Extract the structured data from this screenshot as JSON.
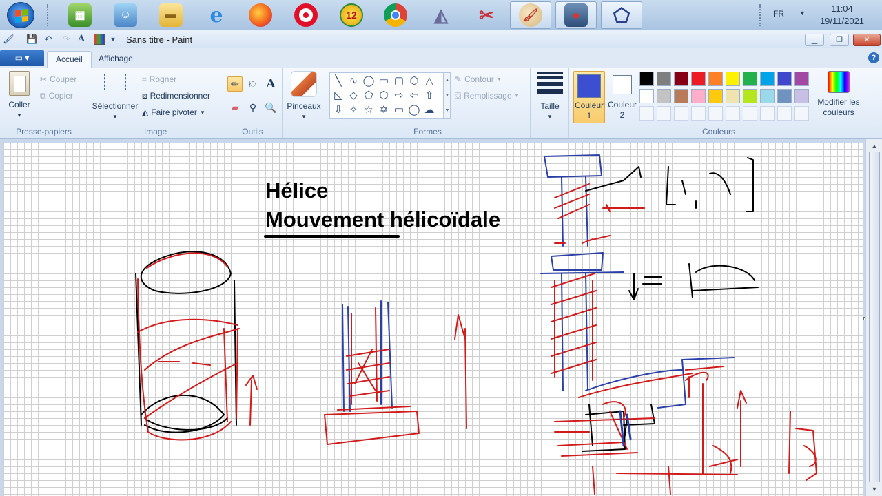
{
  "taskbar": {
    "apps": [
      {
        "name": "fichiers-icon"
      },
      {
        "name": "user-photo-icon"
      },
      {
        "name": "folder-icon"
      },
      {
        "name": "internet-explorer-icon"
      },
      {
        "name": "firefox-icon"
      },
      {
        "name": "opera-icon"
      },
      {
        "name": "app-12-icon",
        "label": "12"
      },
      {
        "name": "chrome-icon"
      },
      {
        "name": "geogebra-icon"
      },
      {
        "name": "snipping-tool-icon"
      },
      {
        "name": "paint-icon"
      },
      {
        "name": "media-icon"
      },
      {
        "name": "polygon-app-icon"
      }
    ],
    "language": "FR",
    "time": "11:04",
    "date": "19/11/2021"
  },
  "titlebar": {
    "title": "Sans titre - Paint"
  },
  "tabs": {
    "home": "Accueil",
    "view": "Affichage"
  },
  "ribbon": {
    "clipboard": {
      "paste": "Coller",
      "cut": "Couper",
      "copy": "Copier",
      "label": "Presse-papiers"
    },
    "image": {
      "select": "Sélectionner",
      "crop": "Rogner",
      "resize": "Redimensionner",
      "rotate": "Faire pivoter",
      "label": "Image"
    },
    "tools": {
      "label": "Outils"
    },
    "brushes": {
      "label": "Pinceaux"
    },
    "shapes": {
      "outline": "Contour",
      "fill": "Remplissage",
      "label": "Formes"
    },
    "size": {
      "label": "Taille"
    },
    "colors": {
      "color1_line1": "Couleur",
      "color1_line2": "1",
      "color2_line1": "Couleur",
      "color2_line2": "2",
      "edit_line1": "Modifier les",
      "edit_line2": "couleurs",
      "label": "Couleurs",
      "color1": "#3c4fd0",
      "color2": "#ffffff",
      "palette_row1": [
        "#000000",
        "#7f7f7f",
        "#880015",
        "#ed1c24",
        "#ff7f27",
        "#fff200",
        "#22b14c",
        "#00a2e8",
        "#3f48cc",
        "#a349a4"
      ],
      "palette_row2": [
        "#ffffff",
        "#c3c3c3",
        "#b97a57",
        "#ffaec9",
        "#ffc90e",
        "#efe4b0",
        "#b5e61d",
        "#99d9ea",
        "#7092be",
        "#c8bfe7"
      ]
    }
  },
  "canvas": {
    "heading1": "Hélice",
    "heading2": "Mouvement hélicoïdale"
  }
}
